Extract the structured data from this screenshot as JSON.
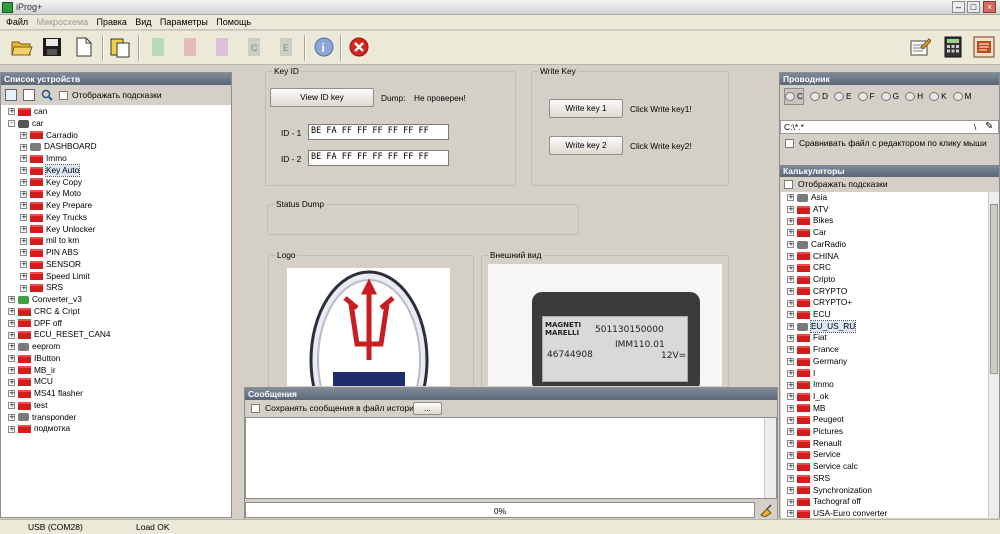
{
  "window": {
    "title": "iProg+"
  },
  "menu": [
    "Файл",
    "Микросхема",
    "Правка",
    "Вид",
    "Параметры",
    "Помощь"
  ],
  "left": {
    "header": "Список устройств",
    "hint_label": "Отображать подсказки",
    "tree": [
      {
        "d": 0,
        "t": "can",
        "s": "+",
        "i": "folder"
      },
      {
        "d": 0,
        "t": "car",
        "s": "-",
        "i": "car"
      },
      {
        "d": 1,
        "t": "Carradio",
        "s": "+",
        "i": "folder"
      },
      {
        "d": 1,
        "t": "DASHBOARD",
        "s": "+",
        "i": "gray"
      },
      {
        "d": 1,
        "t": "Immo",
        "s": "+",
        "i": "folder"
      },
      {
        "d": 1,
        "t": "Key Auto",
        "s": "+",
        "i": "folder",
        "sel": true
      },
      {
        "d": 1,
        "t": "Key Copy",
        "s": "+",
        "i": "folder"
      },
      {
        "d": 1,
        "t": "Key Moto",
        "s": "+",
        "i": "folder"
      },
      {
        "d": 1,
        "t": "Key Prepare",
        "s": "+",
        "i": "folder"
      },
      {
        "d": 1,
        "t": "Key Trucks",
        "s": "+",
        "i": "folder"
      },
      {
        "d": 1,
        "t": "Key Unlocker",
        "s": "+",
        "i": "folder"
      },
      {
        "d": 1,
        "t": "mil to km",
        "s": "+",
        "i": "folder"
      },
      {
        "d": 1,
        "t": "PIN ABS",
        "s": "+",
        "i": "folder"
      },
      {
        "d": 1,
        "t": "SENSOR",
        "s": "+",
        "i": "folder"
      },
      {
        "d": 1,
        "t": "Speed Limit",
        "s": "+",
        "i": "folder"
      },
      {
        "d": 1,
        "t": "SRS",
        "s": "+",
        "i": "folder"
      },
      {
        "d": 0,
        "t": "Converter_v3",
        "s": "+",
        "i": "green"
      },
      {
        "d": 0,
        "t": "CRC & Cript",
        "s": "+",
        "i": "folder"
      },
      {
        "d": 0,
        "t": "DPF off",
        "s": "+",
        "i": "folder"
      },
      {
        "d": 0,
        "t": "ECU_RESET_CAN4",
        "s": "+",
        "i": "folder"
      },
      {
        "d": 0,
        "t": "eeprom",
        "s": "+",
        "i": "gray"
      },
      {
        "d": 0,
        "t": "IButton",
        "s": "+",
        "i": "folder"
      },
      {
        "d": 0,
        "t": "MB_ir",
        "s": "+",
        "i": "folder"
      },
      {
        "d": 0,
        "t": "MCU",
        "s": "+",
        "i": "folder"
      },
      {
        "d": 0,
        "t": "MS41 flasher",
        "s": "+",
        "i": "folder"
      },
      {
        "d": 0,
        "t": "test",
        "s": "+",
        "i": "folder"
      },
      {
        "d": 0,
        "t": "transponder",
        "s": "+",
        "i": "gray"
      },
      {
        "d": 0,
        "t": "подмотка",
        "s": "+",
        "i": "folder"
      }
    ]
  },
  "keyid": {
    "legend": "Key ID",
    "view_btn": "View ID key",
    "dump_label": "Dump:",
    "dump_value": "Не проверен!",
    "id1_label": "ID - 1",
    "id1_value": "BE FA FF FF FF FF FF FF",
    "id2_label": "ID - 2",
    "id2_value": "BE FA FF FF FF FF FF FF"
  },
  "writekey": {
    "legend": "Write Key",
    "btn1": "Write key 1",
    "hint1": "Click Write key1!",
    "btn2": "Write key 2",
    "hint2": "Click Write key2!"
  },
  "status_dump": {
    "legend": "Status Dump"
  },
  "logo": {
    "legend": "Logo"
  },
  "appearance": {
    "legend": "Внешний вид",
    "label_brand": "MAGNETI MARELLI",
    "label_code1": "501130150000",
    "label_code2": "IMM110.01",
    "label_code3": "46744908",
    "label_volt": "12V="
  },
  "messages": {
    "header": "Сообщения",
    "save_label": "Сохранять сообщения в файл истории",
    "browse_btn": "...",
    "progress_text": "0%",
    "progress": 0
  },
  "explorer": {
    "header": "Проводник",
    "drives": [
      "C",
      "D",
      "E",
      "F",
      "G",
      "H",
      "K",
      "M"
    ],
    "path": "C:\\*.*",
    "path_sep": "\\",
    "compare_label": "Сравнивать файл с редактором по клику мыши"
  },
  "calc": {
    "header": "Калькуляторы",
    "hint_label": "Отображать подсказки",
    "tree": [
      {
        "t": "Asia",
        "i": "gray"
      },
      {
        "t": "ATV",
        "i": "folder"
      },
      {
        "t": "Bikes",
        "i": "folder"
      },
      {
        "t": "Car",
        "i": "folder"
      },
      {
        "t": "CarRadio",
        "i": "gray"
      },
      {
        "t": "CHINA",
        "i": "folder"
      },
      {
        "t": "CRC",
        "i": "folder"
      },
      {
        "t": "Cripto",
        "i": "folder"
      },
      {
        "t": "CRYPTO",
        "i": "folder"
      },
      {
        "t": "CRYPTO+",
        "i": "folder"
      },
      {
        "t": "ECU",
        "i": "folder"
      },
      {
        "t": "EU_US_RU",
        "i": "gray",
        "sel": true
      },
      {
        "t": "Fiat",
        "i": "folder"
      },
      {
        "t": "France",
        "i": "folder"
      },
      {
        "t": "Germany",
        "i": "folder"
      },
      {
        "t": "I",
        "i": "folder"
      },
      {
        "t": "Immo",
        "i": "folder"
      },
      {
        "t": "I_ok",
        "i": "folder"
      },
      {
        "t": "MB",
        "i": "folder"
      },
      {
        "t": "Peugeot",
        "i": "folder"
      },
      {
        "t": "Pictures",
        "i": "folder"
      },
      {
        "t": "Renault",
        "i": "folder"
      },
      {
        "t": "Service",
        "i": "folder"
      },
      {
        "t": "Service calc",
        "i": "folder"
      },
      {
        "t": "SRS",
        "i": "folder"
      },
      {
        "t": "Synchronization",
        "i": "folder"
      },
      {
        "t": "Tachograf off",
        "i": "folder"
      },
      {
        "t": "USA-Euro converter",
        "i": "folder"
      }
    ]
  },
  "status": {
    "port": "USB (COM28)",
    "state": "Load OK"
  }
}
